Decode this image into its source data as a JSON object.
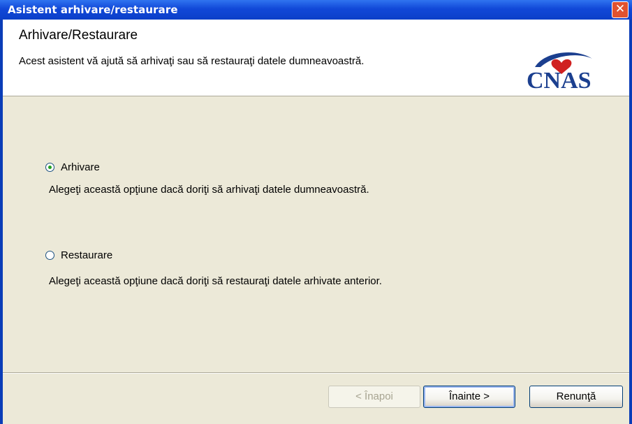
{
  "window": {
    "title": "Asistent arhivare/restaurare",
    "close_glyph": "✕"
  },
  "header": {
    "title": "Arhivare/Restaurare",
    "subtitle": "Acest asistent vă ajută să arhivaţi sau să restauraţi datele dumneavoastră.",
    "logo_text": "CNAS"
  },
  "options": [
    {
      "label": "Arhivare",
      "description": "Alegeţi această opţiune dacă doriţi să arhivaţi datele dumneavoastră.",
      "selected": true
    },
    {
      "label": "Restaurare",
      "description": "Alegeţi această opţiune dacă doriţi să restauraţi datele arhivate anterior.",
      "selected": false
    }
  ],
  "buttons": {
    "back": "< Înapoi",
    "next": "Înainte >",
    "cancel": "Renunţă"
  },
  "colors": {
    "titlebar": "#1148d8",
    "client_bg": "#ece9d8",
    "logo_blue": "#1b3f8f",
    "logo_red": "#d02020"
  }
}
